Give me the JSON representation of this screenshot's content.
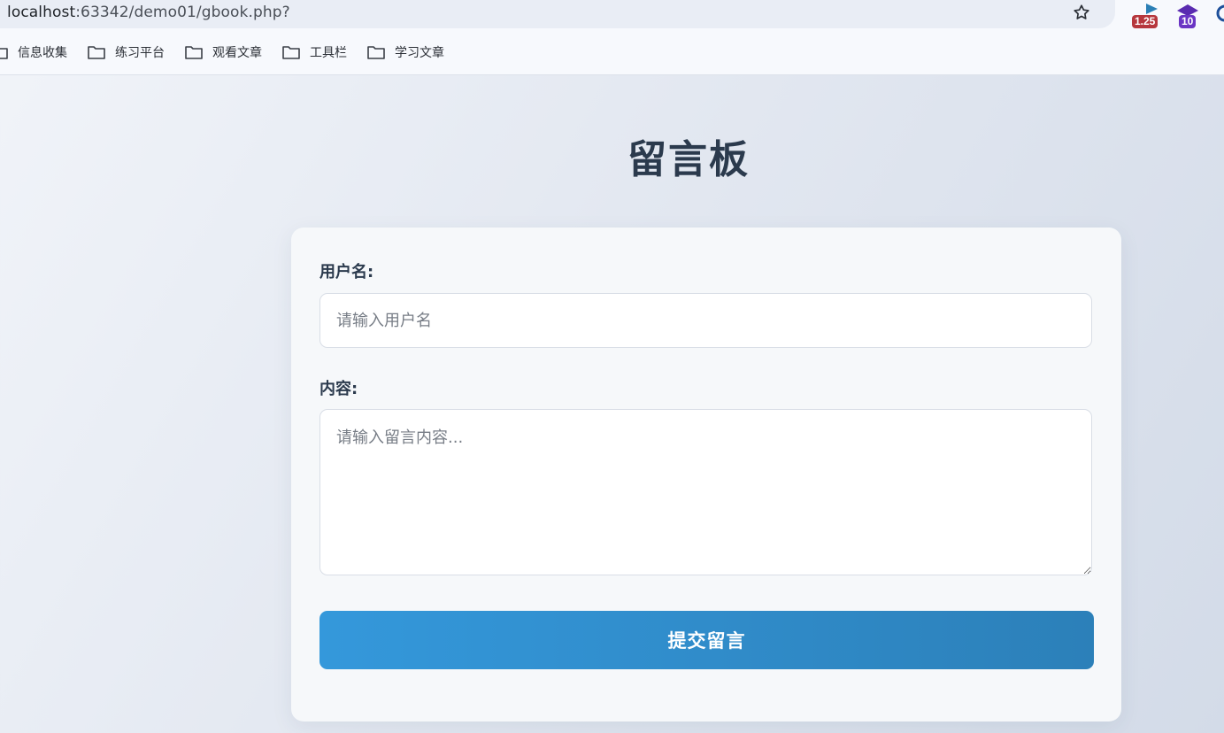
{
  "browser": {
    "url_host": "localhost",
    "url_path": ":63342/demo01/gbook.php?",
    "extensions": [
      {
        "name": "ext-1-25-icon",
        "badge": "1.25",
        "color": "#b6373d"
      },
      {
        "name": "ext-10-icon",
        "badge": "10",
        "color": "#6a35c4"
      }
    ],
    "bookmarks": [
      {
        "label": "信息收集"
      },
      {
        "label": "练习平台"
      },
      {
        "label": "观看文章"
      },
      {
        "label": "工具栏"
      },
      {
        "label": "学习文章"
      }
    ]
  },
  "page": {
    "title": "留言板",
    "form": {
      "username_label": "用户名:",
      "username_placeholder": "请输入用户名",
      "content_label": "内容:",
      "content_placeholder": "请输入留言内容...",
      "submit_label": "提交留言"
    }
  },
  "colors": {
    "title": "#2b3a4d",
    "button_start": "#3498db",
    "button_end": "#2c80b9",
    "card_bg": "#f6f8fa"
  }
}
